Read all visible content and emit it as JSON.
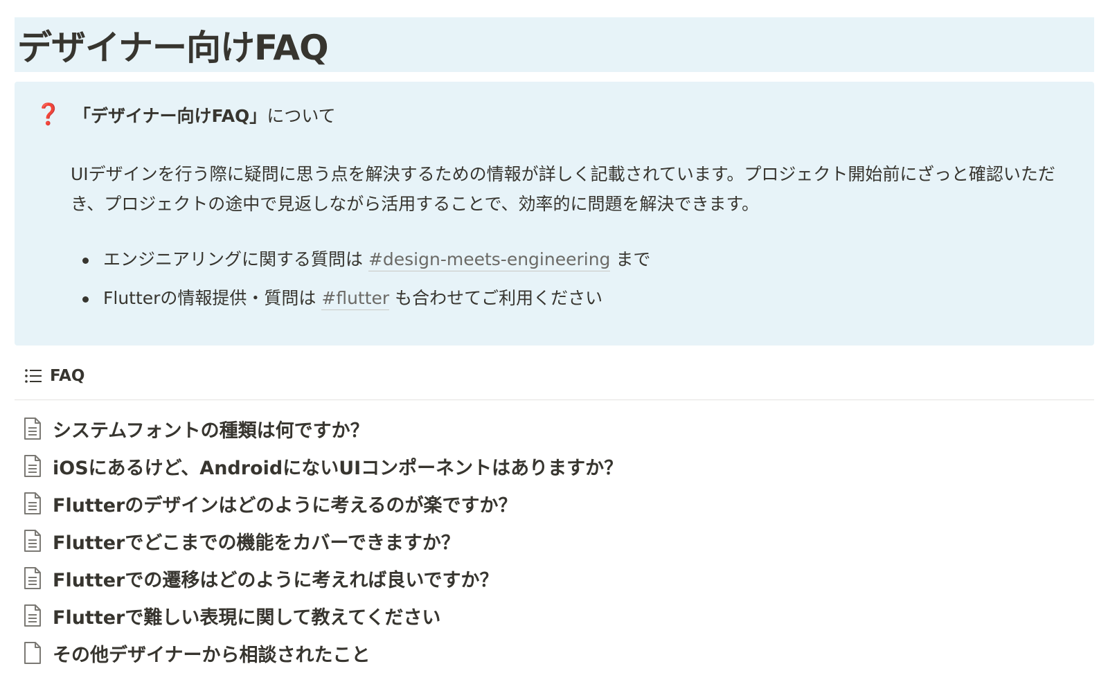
{
  "page": {
    "title": "デザイナー向けFAQ"
  },
  "callout": {
    "icon": "red-question-mark-icon",
    "icon_glyph": "❓",
    "heading_bold": "「デザイナー向けFAQ」",
    "heading_rest": "について",
    "description": "UIデザインを行う際に疑問に思う点を解決するための情報が詳しく記載されています。プロジェクト開始前にざっと確認いただき、プロジェクトの途中で見返しながら活用することで、効率的に問題を解決できます。",
    "bullets": [
      {
        "before": "エンジニアリングに関する質問は ",
        "channel": "#design-meets-engineering",
        "after": " まで"
      },
      {
        "before": "Flutterの情報提供・質問は ",
        "channel": "#flutter",
        "after": " も合わせてご利用ください"
      }
    ]
  },
  "faq": {
    "header_icon": "list-icon",
    "header_label": "FAQ",
    "items": [
      {
        "label": "システムフォントの種類は何ですか？",
        "icon": "document-text-icon"
      },
      {
        "label": "iOSにあるけど、AndroidにないUIコンポーネントはありますか？",
        "icon": "document-text-icon"
      },
      {
        "label": "Flutterのデザインはどのように考えるのが楽ですか？",
        "icon": "document-text-icon"
      },
      {
        "label": "Flutterでどこまでの機能をカバーできますか？",
        "icon": "document-text-icon"
      },
      {
        "label": "Flutterでの遷移はどのように考えれば良いですか？",
        "icon": "document-text-icon"
      },
      {
        "label": "Flutterで難しい表現に関して教えてください",
        "icon": "document-text-icon"
      },
      {
        "label": "その他デザイナーから相談されたこと",
        "icon": "document-blank-icon"
      }
    ]
  },
  "colors": {
    "callout_bg": "#e7f3f8",
    "text": "#37352f",
    "mention": "#6b6a66",
    "icon_red": "#e03e3e"
  }
}
